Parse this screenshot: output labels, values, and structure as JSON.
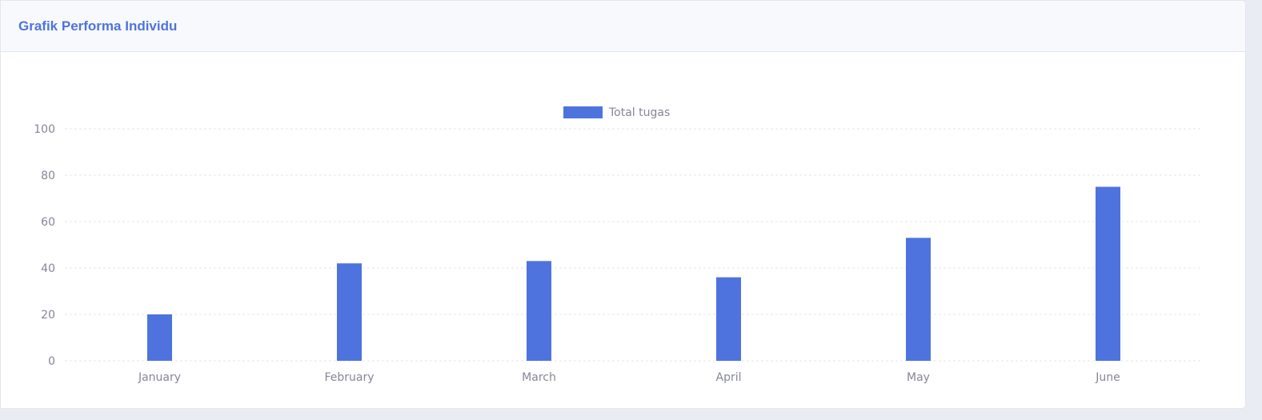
{
  "card": {
    "title": "Grafik Performa Individu"
  },
  "colors": {
    "bar": "#4e73df",
    "grid": "#e3e6f0",
    "tick_text": "#858796",
    "title": "#4e73df"
  },
  "chart_data": {
    "type": "bar",
    "categories": [
      "January",
      "February",
      "March",
      "April",
      "May",
      "June"
    ],
    "series": [
      {
        "name": "Total tugas",
        "values": [
          20,
          42,
          43,
          36,
          53,
          75
        ]
      }
    ],
    "y_ticks": [
      0,
      20,
      40,
      60,
      80,
      100
    ],
    "ylim": [
      0,
      100
    ],
    "grid": true,
    "legend_position": "top-center"
  }
}
